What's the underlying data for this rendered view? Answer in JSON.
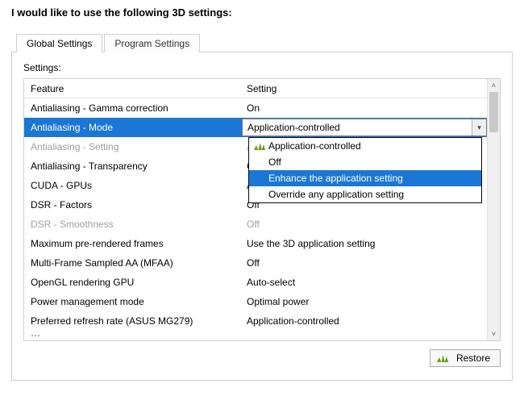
{
  "title": "I would like to use the following 3D settings:",
  "tabs": {
    "global": "Global Settings",
    "program": "Program Settings"
  },
  "settingsLabel": "Settings:",
  "columns": {
    "feature": "Feature",
    "setting": "Setting"
  },
  "rows": [
    {
      "feature": "Antialiasing - Gamma correction",
      "value": "On",
      "state": "normal"
    },
    {
      "feature": "Antialiasing - Mode",
      "value": "Application-controlled",
      "state": "selected"
    },
    {
      "feature": "Antialiasing - Setting",
      "value": "Application-controlled",
      "state": "disabled"
    },
    {
      "feature": "Antialiasing - Transparency",
      "value": "Off",
      "state": "normal"
    },
    {
      "feature": "CUDA - GPUs",
      "value": "All",
      "state": "normal"
    },
    {
      "feature": "DSR - Factors",
      "value": "Off",
      "state": "normal"
    },
    {
      "feature": "DSR - Smoothness",
      "value": "Off",
      "state": "disabled"
    },
    {
      "feature": "Maximum pre-rendered frames",
      "value": "Use the 3D application setting",
      "state": "normal"
    },
    {
      "feature": "Multi-Frame Sampled AA (MFAA)",
      "value": "Off",
      "state": "normal"
    },
    {
      "feature": "OpenGL rendering GPU",
      "value": "Auto-select",
      "state": "normal"
    },
    {
      "feature": "Power management mode",
      "value": "Optimal power",
      "state": "normal"
    },
    {
      "feature": "Preferred refresh rate (ASUS MG279)",
      "value": "Application-controlled",
      "state": "normal"
    }
  ],
  "dropdown": {
    "options": [
      "Application-controlled",
      "Off",
      "Enhance the application setting",
      "Override any application setting"
    ],
    "highlightIndex": 2
  },
  "restoreLabel": "Restore"
}
